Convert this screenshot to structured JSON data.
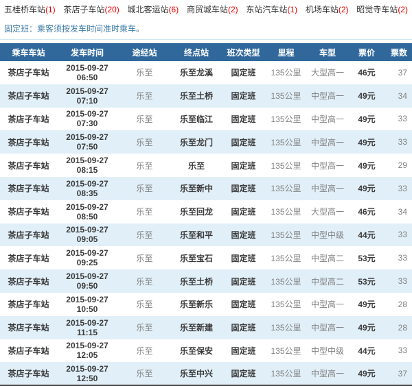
{
  "nav": {
    "items": [
      {
        "label": "五桂桥车站",
        "count": "(1)"
      },
      {
        "label": "茶店子车站",
        "count": "(20)"
      },
      {
        "label": "城北客运站",
        "count": "(6)"
      },
      {
        "label": "商贸城车站",
        "count": "(2)"
      },
      {
        "label": "东站汽车站",
        "count": "(1)"
      },
      {
        "label": "机场车站",
        "count": "(2)"
      },
      {
        "label": "昭觉寺车站",
        "count": "(2)"
      }
    ]
  },
  "notice": "固定班：乘客须按发车时间准时乘车。",
  "table": {
    "headers": [
      "乘车车站",
      "发车时间",
      "途经站",
      "终点站",
      "班次类型",
      "里程",
      "车型",
      "票价",
      "票数"
    ],
    "rows": [
      [
        "茶店子车站",
        "2015-09-27 06:50",
        "乐至",
        "乐至龙溪",
        "固定班",
        "135公里",
        "大型高一",
        "46元",
        "37"
      ],
      [
        "茶店子车站",
        "2015-09-27 07:10",
        "乐至",
        "乐至土桥",
        "固定班",
        "135公里",
        "中型高一",
        "49元",
        "34"
      ],
      [
        "茶店子车站",
        "2015-09-27 07:30",
        "乐至",
        "乐至临江",
        "固定班",
        "135公里",
        "中型高一",
        "49元",
        "33"
      ],
      [
        "茶店子车站",
        "2015-09-27 07:50",
        "乐至",
        "乐至龙门",
        "固定班",
        "135公里",
        "中型高一",
        "49元",
        "33"
      ],
      [
        "茶店子车站",
        "2015-09-27 08:15",
        "乐至",
        "乐至",
        "固定班",
        "135公里",
        "中型高一",
        "49元",
        "29"
      ],
      [
        "茶店子车站",
        "2015-09-27 08:35",
        "乐至",
        "乐至新中",
        "固定班",
        "135公里",
        "中型高一",
        "49元",
        "33"
      ],
      [
        "茶店子车站",
        "2015-09-27 08:50",
        "乐至",
        "乐至回龙",
        "固定班",
        "135公里",
        "大型高一",
        "46元",
        "34"
      ],
      [
        "茶店子车站",
        "2015-09-27 09:05",
        "乐至",
        "乐至和平",
        "固定班",
        "135公里",
        "中型中级",
        "44元",
        "33"
      ],
      [
        "茶店子车站",
        "2015-09-27 09:25",
        "乐至",
        "乐至宝石",
        "固定班",
        "135公里",
        "中型高二",
        "53元",
        "33"
      ],
      [
        "茶店子车站",
        "2015-09-27 09:50",
        "乐至",
        "乐至土桥",
        "固定班",
        "135公里",
        "中型高二",
        "53元",
        "33"
      ],
      [
        "茶店子车站",
        "2015-09-27 10:50",
        "乐至",
        "乐至新乐",
        "固定班",
        "135公里",
        "中型高一",
        "49元",
        "28"
      ],
      [
        "茶店子车站",
        "2015-09-27 11:15",
        "乐至",
        "乐至新建",
        "固定班",
        "135公里",
        "中型高一",
        "49元",
        "28"
      ],
      [
        "茶店子车站",
        "2015-09-27 12:05",
        "乐至",
        "乐至保安",
        "固定班",
        "135公里",
        "中型中级",
        "44元",
        "33"
      ],
      [
        "茶店子车站",
        "2015-09-27 12:50",
        "乐至",
        "乐至中兴",
        "固定班",
        "135公里",
        "中型高一",
        "49元",
        "37"
      ]
    ]
  },
  "colors": {
    "header_bg": "#30689B",
    "alt_row": "#E1EFF8",
    "accent_red": "#E60000",
    "notice_blue": "#3E7CA6"
  }
}
